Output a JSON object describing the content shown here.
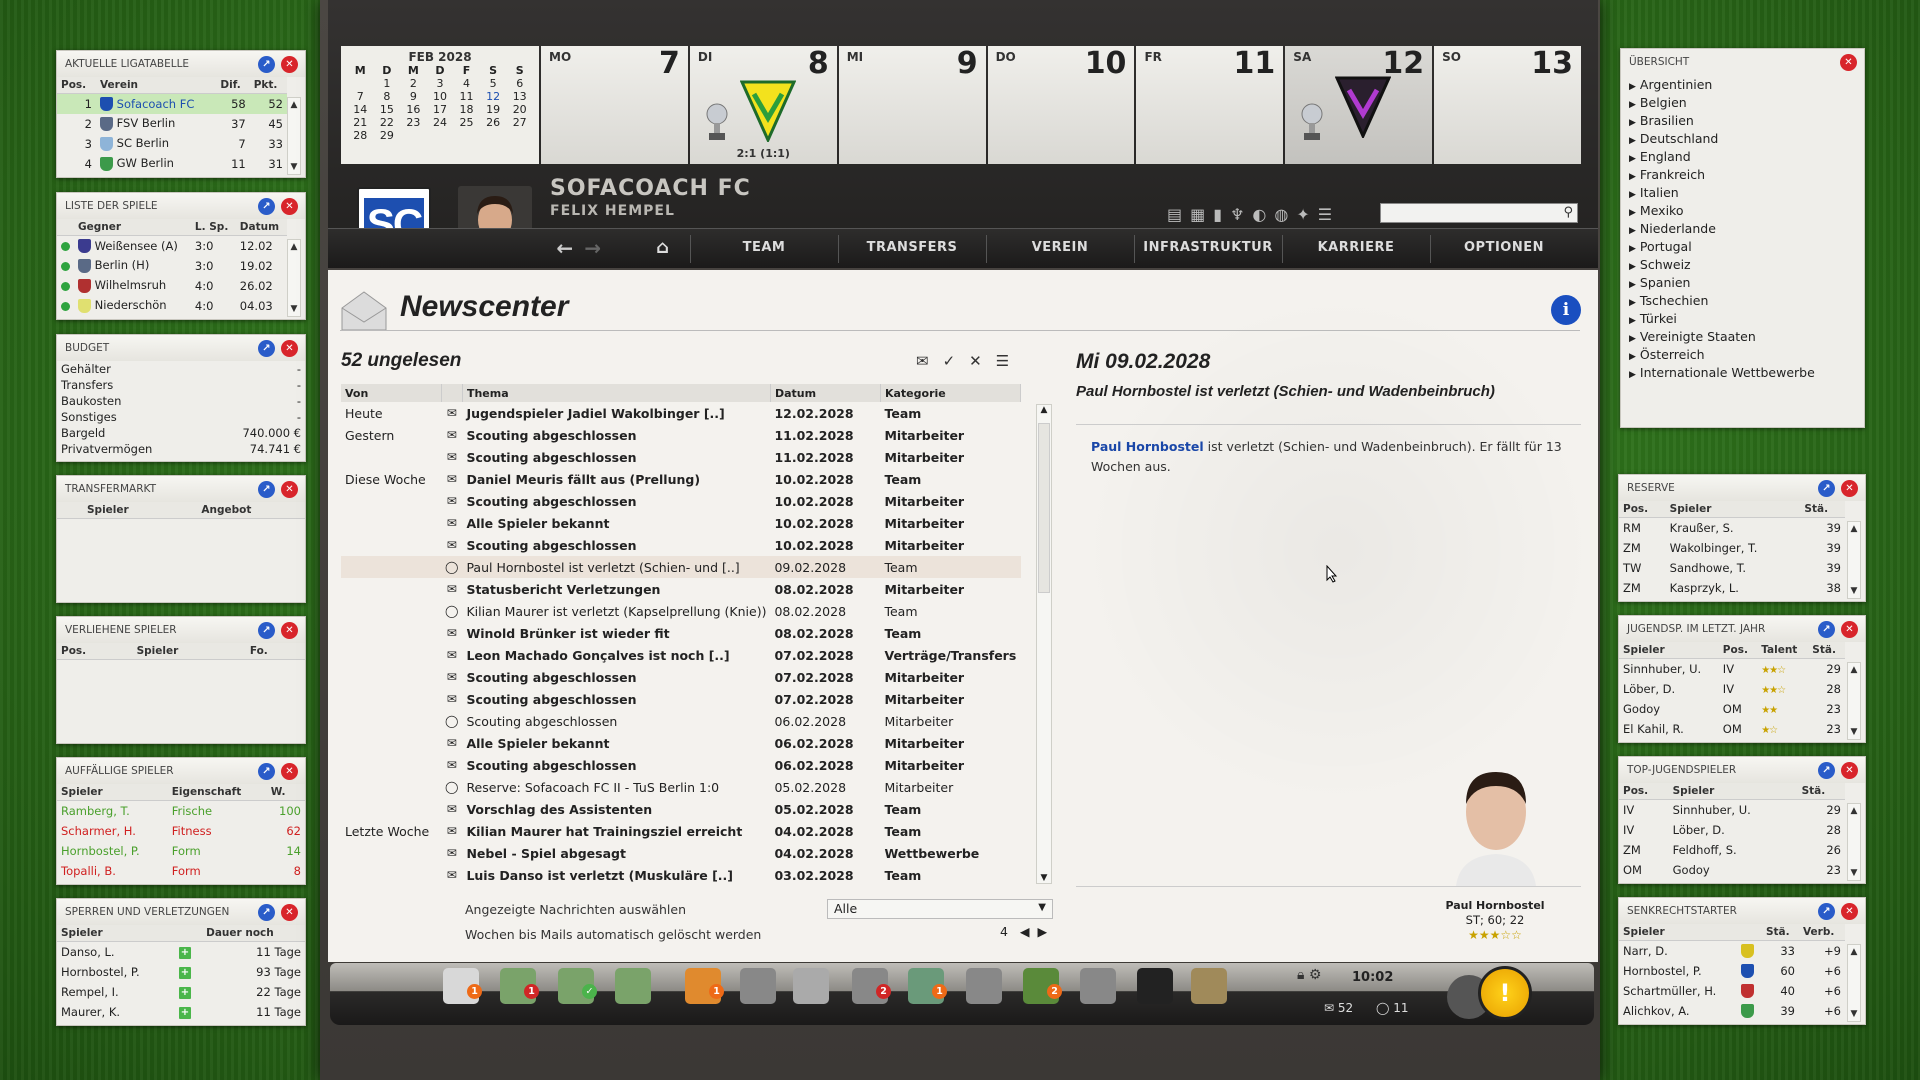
{
  "league": {
    "title": "AKTUELLE LIGATABELLE",
    "cols": [
      "Pos.",
      "Verein",
      "Dif.",
      "Pkt."
    ],
    "rows": [
      {
        "pos": "1",
        "club": "Sofacoach FC",
        "dif": "58",
        "pts": "52",
        "color": "#1d4fb0"
      },
      {
        "pos": "2",
        "club": "FSV Berlin",
        "dif": "37",
        "pts": "45",
        "color": "#5a6a86"
      },
      {
        "pos": "3",
        "club": "SC Berlin",
        "dif": "7",
        "pts": "33",
        "color": "#8eb4d8"
      },
      {
        "pos": "4",
        "club": "GW Berlin",
        "dif": "11",
        "pts": "31",
        "color": "#3c9a4a"
      }
    ]
  },
  "games": {
    "title": "LISTE DER SPIELE",
    "cols": [
      "Gegner",
      "L. Sp.",
      "Datum"
    ],
    "rows": [
      {
        "opp": "Weißensee (A)",
        "last": "3:0",
        "date": "12.02",
        "color": "#3b3b8f",
        "dot": "#2fa33f"
      },
      {
        "opp": "Berlin (H)",
        "last": "3:0",
        "date": "19.02",
        "color": "#5a6a86",
        "dot": "#2fa33f"
      },
      {
        "opp": "Wilhelmsruh",
        "last": "4:0",
        "date": "26.02",
        "color": "#b03030",
        "dot": "#2fa33f"
      },
      {
        "opp": "Niederschön",
        "last": "4:0",
        "date": "04.03",
        "color": "#e0e070",
        "dot": "#2fa33f"
      }
    ]
  },
  "budget": {
    "title": "BUDGET",
    "rows": [
      {
        "k": "Gehälter",
        "v": "-"
      },
      {
        "k": "Transfers",
        "v": "-"
      },
      {
        "k": "Baukosten",
        "v": "-"
      },
      {
        "k": "Sonstiges",
        "v": "-"
      },
      {
        "k": "Bargeld",
        "v": "740.000 €"
      },
      {
        "k": "Privatvermögen",
        "v": "74.741 €"
      }
    ]
  },
  "transfer": {
    "title": "TRANSFERMARKT",
    "cols": [
      "Spieler",
      "Angebot"
    ]
  },
  "loaned": {
    "title": "VERLIEHENE SPIELER",
    "cols": [
      "Pos.",
      "Spieler",
      "Fo."
    ]
  },
  "notable": {
    "title": "AUFFÄLLIGE SPIELER",
    "cols": [
      "Spieler",
      "Eigenschaft",
      "W."
    ],
    "rows": [
      {
        "p": "Ramberg, T.",
        "e": "Frische",
        "w": "100",
        "c": "#4aa02c"
      },
      {
        "p": "Scharmer, H.",
        "e": "Fitness",
        "w": "62",
        "c": "#d02020"
      },
      {
        "p": "Hornbostel, P.",
        "e": "Form",
        "w": "14",
        "c": "#4aa02c"
      },
      {
        "p": "Topalli, B.",
        "e": "Form",
        "w": "8",
        "c": "#d02020"
      }
    ]
  },
  "bans": {
    "title": "SPERREN UND VERLETZUNGEN",
    "cols": [
      "Spieler",
      "Dauer noch"
    ],
    "rows": [
      {
        "p": "Danso, L.",
        "d": "11 Tage"
      },
      {
        "p": "Hornbostel, P.",
        "d": "93 Tage"
      },
      {
        "p": "Rempel, I.",
        "d": "22 Tage"
      },
      {
        "p": "Maurer, K.",
        "d": "11 Tage"
      }
    ]
  },
  "calendar": {
    "month": "FEB 2028",
    "dow": [
      "M",
      "D",
      "M",
      "D",
      "F",
      "S",
      "S"
    ],
    "weeks": [
      [
        "",
        "",
        "1",
        "2",
        "3",
        "4",
        "5",
        "6"
      ],
      [
        "",
        "7",
        "8",
        "9",
        "10",
        "11",
        "12",
        "13"
      ],
      [
        "",
        "14",
        "15",
        "16",
        "17",
        "18",
        "19",
        "20"
      ],
      [
        "",
        "21",
        "22",
        "23",
        "24",
        "25",
        "26",
        "27"
      ],
      [
        "",
        "28",
        "29",
        "",
        "",
        "",
        "",
        ""
      ]
    ],
    "days": [
      {
        "n": "MO",
        "d": "7"
      },
      {
        "n": "DI",
        "d": "8",
        "result": "2:1 (1:1)"
      },
      {
        "n": "MI",
        "d": "9"
      },
      {
        "n": "DO",
        "d": "10"
      },
      {
        "n": "FR",
        "d": "11"
      },
      {
        "n": "SA",
        "d": "12"
      },
      {
        "n": "SO",
        "d": "13"
      }
    ]
  },
  "header": {
    "badge": "SC",
    "club": "SOFACOACH FC",
    "manager": "FELIX HEMPEL"
  },
  "nav": [
    "TEAM",
    "TRANSFERS",
    "VEREIN",
    "INFRASTRUKTUR",
    "KARRIERE",
    "OPTIONEN"
  ],
  "newscenter": {
    "title": "Newscenter",
    "unread": "52 ungelesen",
    "cols": [
      "Von",
      "Thema",
      "Datum",
      "Kategorie"
    ],
    "rows": [
      {
        "von": "Heute",
        "t": "Jugendspieler Jadiel Wakolbinger [..]",
        "d": "12.02.2028",
        "k": "Team",
        "b": true
      },
      {
        "von": "Gestern",
        "t": "Scouting abgeschlossen",
        "d": "11.02.2028",
        "k": "Mitarbeiter",
        "b": true
      },
      {
        "von": "",
        "t": "Scouting abgeschlossen",
        "d": "11.02.2028",
        "k": "Mitarbeiter",
        "b": true
      },
      {
        "von": "Diese Woche",
        "t": "Daniel Meuris fällt aus (Prellung)",
        "d": "10.02.2028",
        "k": "Team",
        "b": true
      },
      {
        "von": "",
        "t": "Scouting abgeschlossen",
        "d": "10.02.2028",
        "k": "Mitarbeiter",
        "b": true
      },
      {
        "von": "",
        "t": "Alle Spieler bekannt",
        "d": "10.02.2028",
        "k": "Mitarbeiter",
        "b": true
      },
      {
        "von": "",
        "t": "Scouting abgeschlossen",
        "d": "10.02.2028",
        "k": "Mitarbeiter",
        "b": true
      },
      {
        "von": "",
        "t": "Paul Hornbostel ist verletzt (Schien- und [..]",
        "d": "09.02.2028",
        "k": "Team",
        "b": false,
        "sel": true
      },
      {
        "von": "",
        "t": "Statusbericht Verletzungen",
        "d": "08.02.2028",
        "k": "Mitarbeiter",
        "b": true
      },
      {
        "von": "",
        "t": "Kilian Maurer ist verletzt (Kapselprellung (Knie))",
        "d": "08.02.2028",
        "k": "Team",
        "b": false
      },
      {
        "von": "",
        "t": "Winold Brünker ist wieder fit",
        "d": "08.02.2028",
        "k": "Team",
        "b": true
      },
      {
        "von": "",
        "t": "Leon Machado Gonçalves ist noch [..]",
        "d": "07.02.2028",
        "k": "Verträge/Transfers",
        "b": true
      },
      {
        "von": "",
        "t": "Scouting abgeschlossen",
        "d": "07.02.2028",
        "k": "Mitarbeiter",
        "b": true
      },
      {
        "von": "",
        "t": "Scouting abgeschlossen",
        "d": "07.02.2028",
        "k": "Mitarbeiter",
        "b": true
      },
      {
        "von": "",
        "t": "Scouting abgeschlossen",
        "d": "06.02.2028",
        "k": "Mitarbeiter",
        "b": false
      },
      {
        "von": "",
        "t": "Alle Spieler bekannt",
        "d": "06.02.2028",
        "k": "Mitarbeiter",
        "b": true
      },
      {
        "von": "",
        "t": "Scouting abgeschlossen",
        "d": "06.02.2028",
        "k": "Mitarbeiter",
        "b": true
      },
      {
        "von": "",
        "t": "Reserve: Sofacoach FC II - TuS Berlin 1:0",
        "d": "05.02.2028",
        "k": "Mitarbeiter",
        "b": false
      },
      {
        "von": "",
        "t": "Vorschlag des Assistenten",
        "d": "05.02.2028",
        "k": "Team",
        "b": true
      },
      {
        "von": "Letzte Woche",
        "t": "Kilian Maurer hat Trainingsziel erreicht",
        "d": "04.02.2028",
        "k": "Team",
        "b": true
      },
      {
        "von": "",
        "t": "Nebel - Spiel abgesagt",
        "d": "04.02.2028",
        "k": "Wettbewerbe",
        "b": true
      },
      {
        "von": "",
        "t": "Luis Danso ist verletzt (Muskuläre [..]",
        "d": "03.02.2028",
        "k": "Team",
        "b": true
      }
    ],
    "opt1": "Angezeigte Nachrichten auswählen",
    "opt1_val": "Alle",
    "opt2": "Wochen bis Mails automatisch gelöscht werden",
    "opt2_val": "4"
  },
  "reader": {
    "date": "Mi 09.02.2028",
    "subject": "Paul Hornbostel ist verletzt (Schien- und Wadenbeinbruch)",
    "link": "Paul Hornbostel",
    "body": " ist verletzt (Schien- und Wadenbeinbruch). Er fällt für 13 Wochen aus.",
    "player": "Paul Hornbostel",
    "pos": "ST; 60; 22"
  },
  "dock": {
    "time": "10:02",
    "mails": "52",
    "chats": "11",
    "badges": [
      "1",
      "1",
      "",
      "",
      "1",
      "",
      "",
      "2",
      "1",
      "",
      "",
      "2"
    ]
  },
  "overview": {
    "title": "ÜBERSICHT",
    "items": [
      "Argentinien",
      "Belgien",
      "Brasilien",
      "Deutschland",
      "England",
      "Frankreich",
      "Italien",
      "Mexiko",
      "Niederlande",
      "Portugal",
      "Schweiz",
      "Spanien",
      "Tschechien",
      "Türkei",
      "Vereinigte Staaten",
      "Österreich",
      "Internationale Wettbewerbe"
    ]
  },
  "reserve": {
    "title": "RESERVE",
    "cols": [
      "Pos.",
      "Spieler",
      "Stä."
    ],
    "rows": [
      {
        "pos": "RM",
        "p": "Kraußer, S.",
        "s": "39"
      },
      {
        "pos": "ZM",
        "p": "Wakolbinger, T.",
        "s": "39"
      },
      {
        "pos": "TW",
        "p": "Sandhowe, T.",
        "s": "39"
      },
      {
        "pos": "ZM",
        "p": "Kasprzyk, L.",
        "s": "38"
      }
    ]
  },
  "youthlast": {
    "title": "JUGENDSP. IM LETZT. JAHR",
    "cols": [
      "Spieler",
      "Pos.",
      "Talent",
      "Stä."
    ],
    "rows": [
      {
        "p": "Sinnhuber, U.",
        "pos": "IV",
        "t": "★★☆",
        "s": "29"
      },
      {
        "p": "Löber, D.",
        "pos": "IV",
        "t": "★★☆",
        "s": "28"
      },
      {
        "p": "Godoy",
        "pos": "OM",
        "t": "★★",
        "s": "23"
      },
      {
        "p": "El Kahil, R.",
        "pos": "OM",
        "t": "★☆",
        "s": "23"
      }
    ]
  },
  "topyouth": {
    "title": "TOP-JUGENDSPIELER",
    "cols": [
      "Pos.",
      "Spieler",
      "Stä."
    ],
    "rows": [
      {
        "pos": "IV",
        "p": "Sinnhuber, U.",
        "s": "29"
      },
      {
        "pos": "IV",
        "p": "Löber, D.",
        "s": "28"
      },
      {
        "pos": "ZM",
        "p": "Feldhoff, S.",
        "s": "26"
      },
      {
        "pos": "OM",
        "p": "Godoy",
        "s": "23"
      }
    ]
  },
  "risers": {
    "title": "SENKRECHTSTARTER",
    "cols": [
      "Spieler",
      "Stä.",
      "Verb."
    ],
    "rows": [
      {
        "p": "Narr, D.",
        "s": "33",
        "v": "+9",
        "c": "#d8c020"
      },
      {
        "p": "Hornbostel, P.",
        "s": "60",
        "v": "+6",
        "c": "#1d4fb0"
      },
      {
        "p": "Schartmüller, H.",
        "s": "40",
        "v": "+6",
        "c": "#c03030"
      },
      {
        "p": "Alichkov, A.",
        "s": "39",
        "v": "+6",
        "c": "#3c9a4a"
      }
    ]
  }
}
